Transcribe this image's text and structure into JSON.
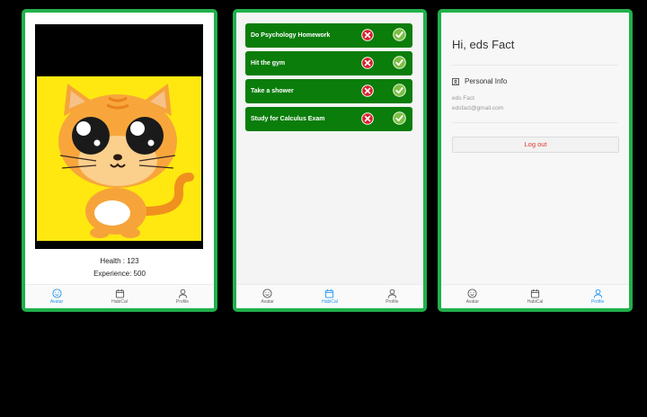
{
  "avatar_screen": {
    "health_label": "Health : 123",
    "experience_label": "Experience: 500"
  },
  "habits_screen": {
    "tasks": [
      {
        "name": "Do Psychology Homework"
      },
      {
        "name": "Hit the gym"
      },
      {
        "name": "Take a shower"
      },
      {
        "name": "Study for Calculus Exam"
      }
    ]
  },
  "profile_screen": {
    "greeting": "Hi, eds Fact",
    "section_title": "Personal Info",
    "name": "eds Fact",
    "email": "edsfact@gmail.com",
    "logout_label": "Log out"
  },
  "tabs": [
    {
      "label": "Avatar",
      "icon": "smiley-icon"
    },
    {
      "label": "HabiCal",
      "icon": "calendar-icon"
    },
    {
      "label": "Profile",
      "icon": "person-icon"
    }
  ],
  "colors": {
    "frame_border": "#21b04b",
    "task_bg": "#0b7d0b",
    "active_tab": "#2196f3",
    "logout_text": "#e53935",
    "avatar_bg": "#ffe810"
  }
}
